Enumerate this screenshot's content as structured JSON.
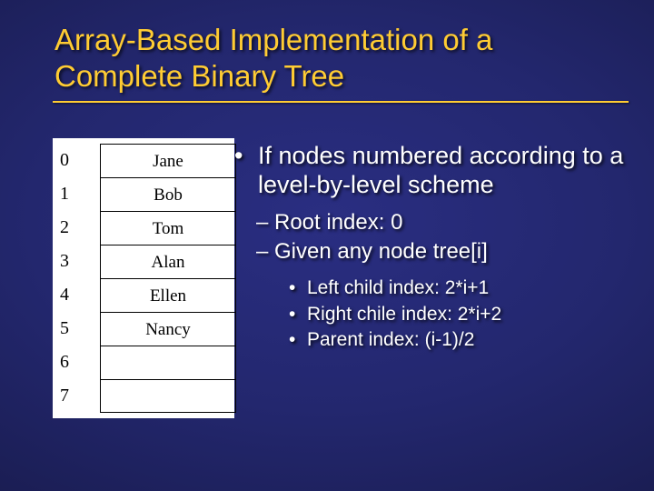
{
  "title_line1": "Array-Based Implementation of a",
  "title_line2": "Complete Binary Tree",
  "array_table": {
    "indices": [
      "0",
      "1",
      "2",
      "3",
      "4",
      "5",
      "6",
      "7"
    ],
    "values": [
      "Jane",
      "Bob",
      "Tom",
      "Alan",
      "Ellen",
      "Nancy",
      "",
      ""
    ]
  },
  "bullets": {
    "b1": "If nodes numbered according to a level-by-level scheme",
    "b2a": "Root index: 0",
    "b2b": "Given any node tree[i]",
    "b3a": "Left child index: 2*i+1",
    "b3b": "Right chile index: 2*i+2",
    "b3c": "Parent index: (i-1)/2"
  }
}
